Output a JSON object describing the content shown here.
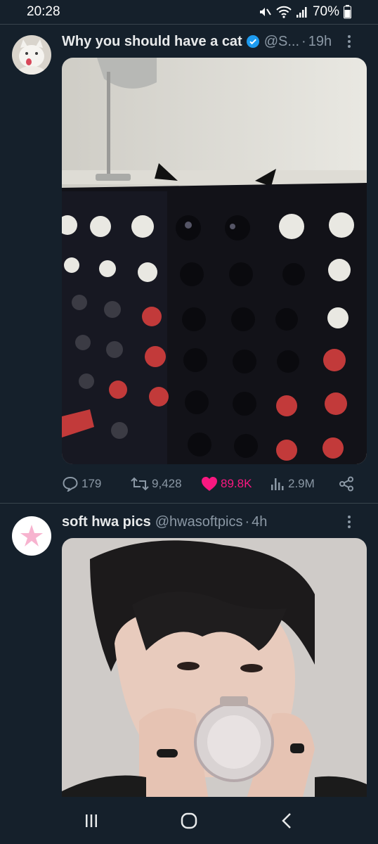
{
  "status": {
    "time": "20:28",
    "battery": "70%"
  },
  "tweets": [
    {
      "name": "Why you should have a cat",
      "handle": "@S...",
      "separator": "·",
      "time": "19h",
      "actions": {
        "replies": "179",
        "retweets": "9,428",
        "likes": "89.8K",
        "views": "2.9M"
      }
    },
    {
      "name": "soft hwa pics",
      "handle": "@hwasoftpics",
      "separator": "·",
      "time": "4h"
    }
  ],
  "colors": {
    "background": "#15202b",
    "verified": "#1d9bf0",
    "like": "#f91880",
    "muted": "#8b98a5"
  },
  "icons": [
    "mute-icon",
    "wifi-icon",
    "signal-icon",
    "battery-icon",
    "verified-badge-icon",
    "more-icon",
    "reply-icon",
    "retweet-icon",
    "like-icon",
    "views-icon",
    "share-icon",
    "recents-icon",
    "home-icon",
    "back-icon"
  ]
}
